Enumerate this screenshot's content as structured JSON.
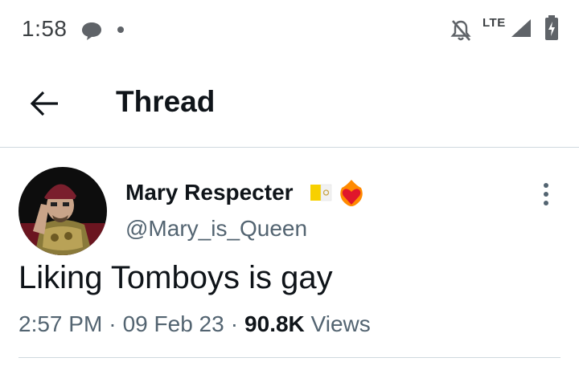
{
  "status_bar": {
    "time": "1:58",
    "network": "LTE",
    "icons": [
      "message-icon",
      "notification-dot",
      "bell-off-icon",
      "signal-icon",
      "battery-charging-icon"
    ]
  },
  "toolbar": {
    "title": "Thread",
    "back_icon": "arrow-left-icon"
  },
  "tweet": {
    "display_name": "Mary Respecter",
    "name_emojis": [
      "vatican-flag-icon",
      "heart-on-fire-icon"
    ],
    "handle": "@Mary_is_Queen",
    "text": "Liking Tomboys is gay",
    "time": "2:57 PM",
    "date": "09 Feb 23",
    "separator": "·",
    "views_count": "90.8K",
    "views_label": "Views"
  },
  "colors": {
    "text_primary": "#0f1419",
    "text_secondary": "#536471",
    "divider": "#cfd9de"
  }
}
